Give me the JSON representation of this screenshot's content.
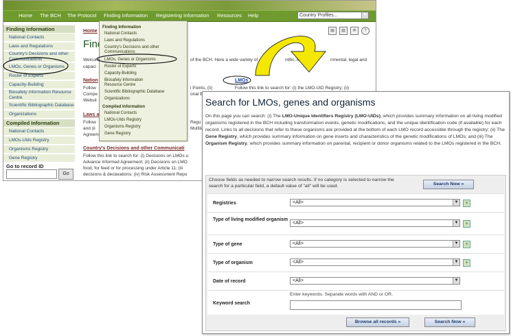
{
  "topnav": {
    "items": [
      "Home",
      "The BCH",
      "The Protocol",
      "Finding Information",
      "Registering Information",
      "Resources",
      "Help"
    ],
    "country_select": "Country Profiles..."
  },
  "sidebar": {
    "finding_header": "Finding Information",
    "finding_items": [
      "National Contacts",
      "Laws and Regulations",
      "Country's Decisions and other Communications",
      "LMOs, Genes or Organisms",
      "Roster of Experts",
      "Capacity-Building",
      "Biosafety Information Resource Centre",
      "Scientific Bibliographic Database",
      "Organizations"
    ],
    "compiled_header": "Compiled Information",
    "compiled_items": [
      "National Contacts",
      "LMOs-UIds Registry",
      "Organisms Registry",
      "Gene Registry"
    ],
    "goto_label": "Go to record ID",
    "goto_button": "Go"
  },
  "main": {
    "breadcrumb": "Home",
    "title": "Findi",
    "intro_line1": "Welcom",
    "intro_frag1": "of the BCH. Here a wide variety of",
    "intro_frag2": "ntific, technic",
    "intro_frag3": "nmental, legal and",
    "intro_line2": "capaci",
    "sec1_link": "Nation",
    "sec1_line1": "Follow",
    "sec1_frag1": "l Points, (ii)",
    "sec1_line2": "Compe",
    "sec1_frag2": "onal Bio",
    "sec1_line3": "Websit",
    "lmos_link": "LMOs",
    "lmos_desc": "Follow this link to search for: (i) the LMO-UID Registry; (ii)",
    "sec2_link": "Laws a",
    "sec2_line1": "Follow",
    "sec2_frag1": "Regu",
    "sec2_line2": "and (ii",
    "sec2_frag2": "Multila",
    "sec2_line3": "Agreem",
    "sec3_link": "Country's Decisions and other Communicati",
    "sec3_line1": "Follow this link to search for: (i) Decisions on LMOs u",
    "sec3_line2": "Advance Informed Agreement; (ii) Decisions on LMO",
    "sec3_line3": "food, for feed or for processing under Article 11; (iii",
    "sec3_line4": "decisions & declarations; (iv) Risk Assessment Repo"
  },
  "dropdown": {
    "finding_header": "Finding Information",
    "finding_items": [
      "National Contacts",
      "Laws and Regulations",
      "Country's Decisions and other Communications",
      "LMOs, Genes or Organisms",
      "Roster of Experts",
      "Capacity-Building",
      "Biosafety Information Resource Centre",
      "Scientific Bibliographic Database",
      "Organizations"
    ],
    "compiled_header": "Compiled Information",
    "compiled_items": [
      "National Contacts",
      "LMOs-UIds Registry",
      "Organisms Registry",
      "Gene Registry"
    ]
  },
  "search": {
    "title": "Search for LMOs, genes and organisms",
    "desc": {
      "p1": "On this page you can search: (i) The ",
      "b1": "LMO-Unique Identifiers Registry (LMO-UIDs)",
      "p2": ", which provides summary information on all living modified organisms registered in the BCH including transformation events, genetic modifications, and the unique identification code (if available) for each record. Links to all decisions that refer to these organisms are provided at the bottom of each LMO record accessible through the registry; (ii) The ",
      "b2": "Gene Registry",
      "p3": ", which provides summary information on gene inserts and characteristics of the genetic modifications of LMOs; and (iii) The ",
      "b3": "Organism Registry",
      "p4": ", which provides summary information on parental, recipient or donor organisms related to the LMOs registered in the BCH."
    },
    "hint": "Choose fields as needed to narrow search results. If no category is selected to narrow the search for a particular field, a default value of \"all\" will be used.",
    "search_now": "Search Now »",
    "rows": [
      {
        "label": "Registries",
        "value": "<All>"
      },
      {
        "label": "Type of living modified organism",
        "value": "<All>"
      },
      {
        "label": "Type of gene",
        "value": "<All>"
      },
      {
        "label": "Type of organism",
        "value": "<All>"
      },
      {
        "label": "Date of record",
        "value": "<All>"
      }
    ],
    "keyword_label": "Keyword search",
    "keyword_hint": "Enter keywords. Separate words with AND or OR.",
    "browse_all": "Browse all records »",
    "search_now_bottom": "Search Now »"
  },
  "colors": {
    "nav_green": "#6f9a2d",
    "sidebar_bg": "#e9eed8",
    "arrow_yellow": "#f4e800"
  }
}
